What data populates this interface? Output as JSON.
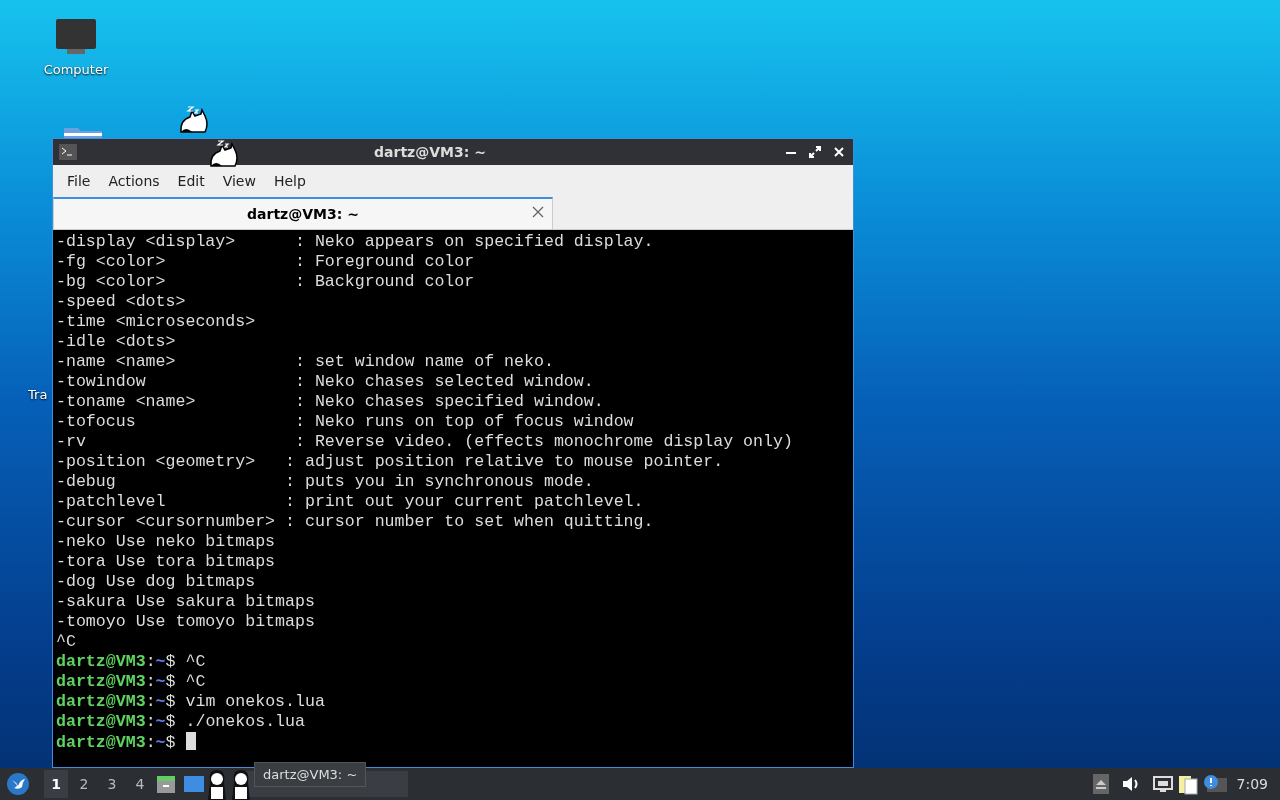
{
  "desktop_icons": [
    {
      "kind": "computer",
      "label": "Computer"
    },
    {
      "kind": "folder",
      "label": "Tra"
    }
  ],
  "window": {
    "title": "dartz@VM3: ~",
    "menu": [
      "File",
      "Actions",
      "Edit",
      "View",
      "Help"
    ],
    "tabs": [
      {
        "label": "dartz@VM3: ~",
        "selected": true
      }
    ],
    "lines": [
      {
        "kind": "output",
        "text": "-display <display>      : Neko appears on specified display."
      },
      {
        "kind": "output",
        "text": "-fg <color>             : Foreground color"
      },
      {
        "kind": "output",
        "text": "-bg <color>             : Background color"
      },
      {
        "kind": "output",
        "text": "-speed <dots>"
      },
      {
        "kind": "output",
        "text": "-time <microseconds>"
      },
      {
        "kind": "output",
        "text": "-idle <dots>"
      },
      {
        "kind": "output",
        "text": "-name <name>            : set window name of neko."
      },
      {
        "kind": "output",
        "text": "-towindow               : Neko chases selected window."
      },
      {
        "kind": "output",
        "text": "-toname <name>          : Neko chases specified window."
      },
      {
        "kind": "output",
        "text": "-tofocus                : Neko runs on top of focus window"
      },
      {
        "kind": "output",
        "text": "-rv                     : Reverse video. (effects monochrome display only)"
      },
      {
        "kind": "output",
        "text": "-position <geometry>   : adjust position relative to mouse pointer."
      },
      {
        "kind": "output",
        "text": "-debug                 : puts you in synchronous mode."
      },
      {
        "kind": "output",
        "text": "-patchlevel            : print out your current patchlevel."
      },
      {
        "kind": "output",
        "text": "-cursor <cursornumber> : cursor number to set when quitting."
      },
      {
        "kind": "output",
        "text": "-neko Use neko bitmaps"
      },
      {
        "kind": "output",
        "text": "-tora Use tora bitmaps"
      },
      {
        "kind": "output",
        "text": "-dog Use dog bitmaps"
      },
      {
        "kind": "output",
        "text": "-sakura Use sakura bitmaps"
      },
      {
        "kind": "output",
        "text": "-tomoyo Use tomoyo bitmaps"
      },
      {
        "kind": "output",
        "text": "^C"
      },
      {
        "kind": "prompt",
        "user": "dartz@VM3",
        "separator": ":",
        "path": "~",
        "symbol": "$",
        "command": "^C"
      },
      {
        "kind": "prompt",
        "user": "dartz@VM3",
        "separator": ":",
        "path": "~",
        "symbol": "$",
        "command": "^C"
      },
      {
        "kind": "prompt",
        "user": "dartz@VM3",
        "separator": ":",
        "path": "~",
        "symbol": "$",
        "command": "vim onekos.lua"
      },
      {
        "kind": "prompt",
        "user": "dartz@VM3",
        "separator": ":",
        "path": "~",
        "symbol": "$",
        "command": "./onekos.lua"
      },
      {
        "kind": "prompt",
        "user": "dartz@VM3",
        "separator": ":",
        "path": "~",
        "symbol": "$",
        "cursor": true
      }
    ]
  },
  "taskbar": {
    "workspaces": [
      {
        "label": "1",
        "selected": true
      },
      {
        "label": "2",
        "selected": false
      },
      {
        "label": "3",
        "selected": false
      },
      {
        "label": "4",
        "selected": false
      }
    ],
    "tooltip": "dartz@VM3: ~",
    "clock": "7:09"
  }
}
